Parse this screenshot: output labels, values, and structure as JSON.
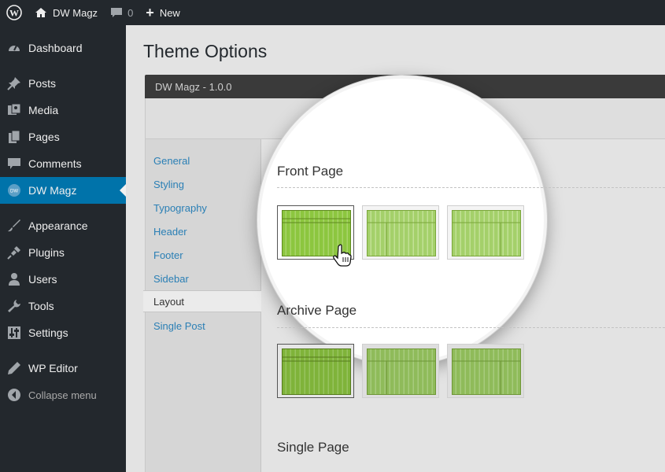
{
  "adminbar": {
    "site_name": "DW Magz",
    "comments_count": "0",
    "new_label": "New"
  },
  "sidebar": {
    "items": [
      {
        "label": "Dashboard",
        "icon": "dashboard-icon"
      },
      {
        "label": "Posts",
        "icon": "pin-icon"
      },
      {
        "label": "Media",
        "icon": "media-icon"
      },
      {
        "label": "Pages",
        "icon": "pages-icon"
      },
      {
        "label": "Comments",
        "icon": "comment-icon"
      },
      {
        "label": "DW Magz",
        "icon": "dw-icon",
        "active": true
      },
      {
        "label": "Appearance",
        "icon": "brush-icon"
      },
      {
        "label": "Plugins",
        "icon": "plug-icon"
      },
      {
        "label": "Users",
        "icon": "user-icon"
      },
      {
        "label": "Tools",
        "icon": "wrench-icon"
      },
      {
        "label": "Settings",
        "icon": "settings-icon"
      },
      {
        "label": "WP Editor",
        "icon": "pencil-icon"
      }
    ],
    "collapse_label": "Collapse menu"
  },
  "page": {
    "title": "Theme Options",
    "panel_title": "DW Magz - 1.0.0"
  },
  "subnav": {
    "items": [
      "General",
      "Styling",
      "Typography",
      "Header",
      "Footer",
      "Sidebar",
      "Layout",
      "Single Post"
    ],
    "active": "Layout"
  },
  "sections": {
    "front_page": "Front Page",
    "archive_page": "Archive Page",
    "single_page": "Single Page"
  },
  "colors": {
    "accent": "#0073aa",
    "layout_green": "#8cc63f",
    "layout_green_dark": "#5f8a1f"
  }
}
